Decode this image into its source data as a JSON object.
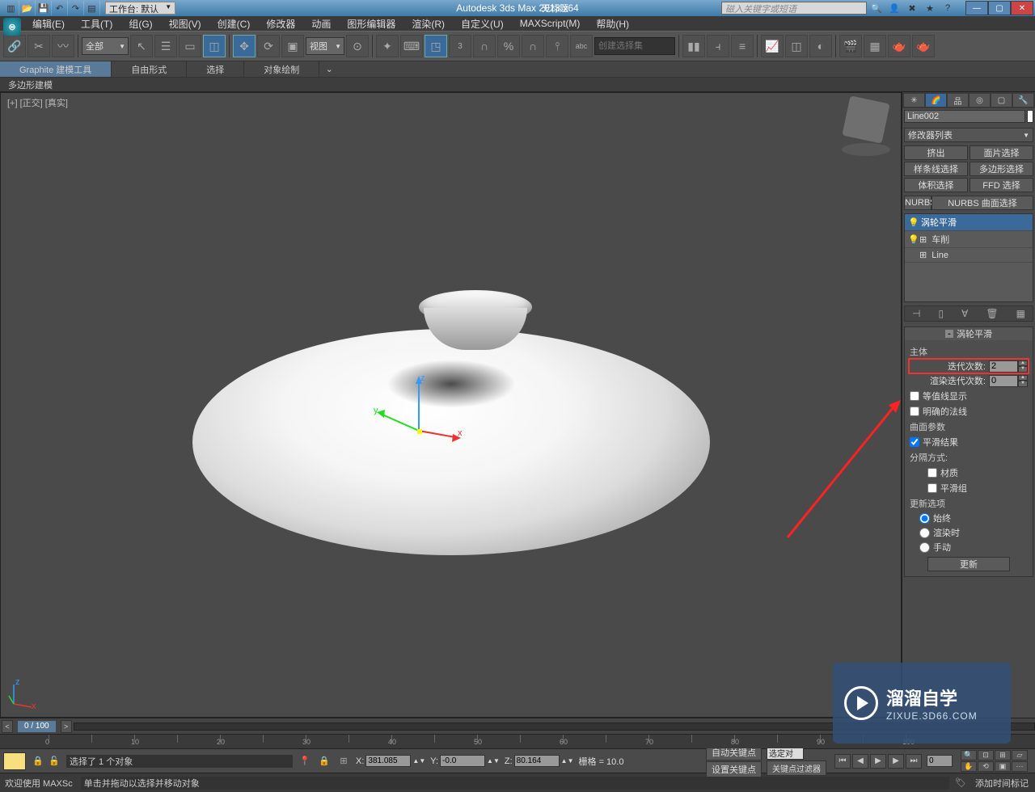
{
  "title_app": "Autodesk 3ds Max  2013 x64",
  "title_doc": "无标题",
  "workspace_label": "工作台: 默认",
  "search_placeholder": "磁入关键字或短语",
  "menus": [
    "编辑(E)",
    "工具(T)",
    "组(G)",
    "视图(V)",
    "创建(C)",
    "修改器",
    "动画",
    "图形编辑器",
    "渲染(R)",
    "自定义(U)",
    "MAXScript(M)",
    "帮助(H)"
  ],
  "filter_all": "全部",
  "view_dd": "视图",
  "create_set_placeholder": "创建选择集",
  "ribbon_tabs": [
    "Graphite 建模工具",
    "自由形式",
    "选择",
    "对象绘制"
  ],
  "subribbon": "多边形建模",
  "viewport_label": "[+] [正交] [真实]",
  "rpanel": {
    "obj_name": "Line002",
    "modlist": "修改器列表",
    "btns": [
      "挤出",
      "面片选择",
      "样条线选择",
      "多边形选择",
      "体积选择",
      "FFD 选择"
    ],
    "wide_btn": "NURBS 曲面选择",
    "stack": [
      {
        "icon": "💡",
        "label": "涡轮平滑",
        "sel": true
      },
      {
        "icon": "💡",
        "label": "车削",
        "sel": false
      },
      {
        "icon": "",
        "label": "Line",
        "sel": false
      }
    ]
  },
  "rollout": {
    "title": "涡轮平滑",
    "group1": "主体",
    "iter_label": "迭代次数:",
    "iter_val": "2",
    "render_iter_label": "渲染迭代次数:",
    "render_iter_val": "0",
    "ck_isoline": "等值线显示",
    "ck_normals": "明确的法线",
    "group2": "曲面参数",
    "ck_smooth": "平滑结果",
    "sep_label": "分隔方式:",
    "ck_mat": "材质",
    "ck_smg": "平滑组",
    "group3": "更新选项",
    "r_always": "始终",
    "r_render": "渲染时",
    "r_manual": "手动",
    "update_btn": "更新"
  },
  "timeline": {
    "frame": "0 / 100"
  },
  "status": {
    "selected": "选择了 1 个对象",
    "x": "381.085",
    "y": "-0.0",
    "z": "80.164",
    "grid": "栅格 = 10.0",
    "autokey": "自动关键点",
    "setkey": "设置关键点",
    "selkey": "选定对",
    "keyfilter": "关键点过滤器",
    "addmark": "添加时间标记"
  },
  "bottom": {
    "welcome": "欢迎使用 MAXSc",
    "hint": "单击并拖动以选择并移动对象"
  },
  "watermark": {
    "big": "溜溜自学",
    "small": "ZIXUE.3D66.COM"
  }
}
